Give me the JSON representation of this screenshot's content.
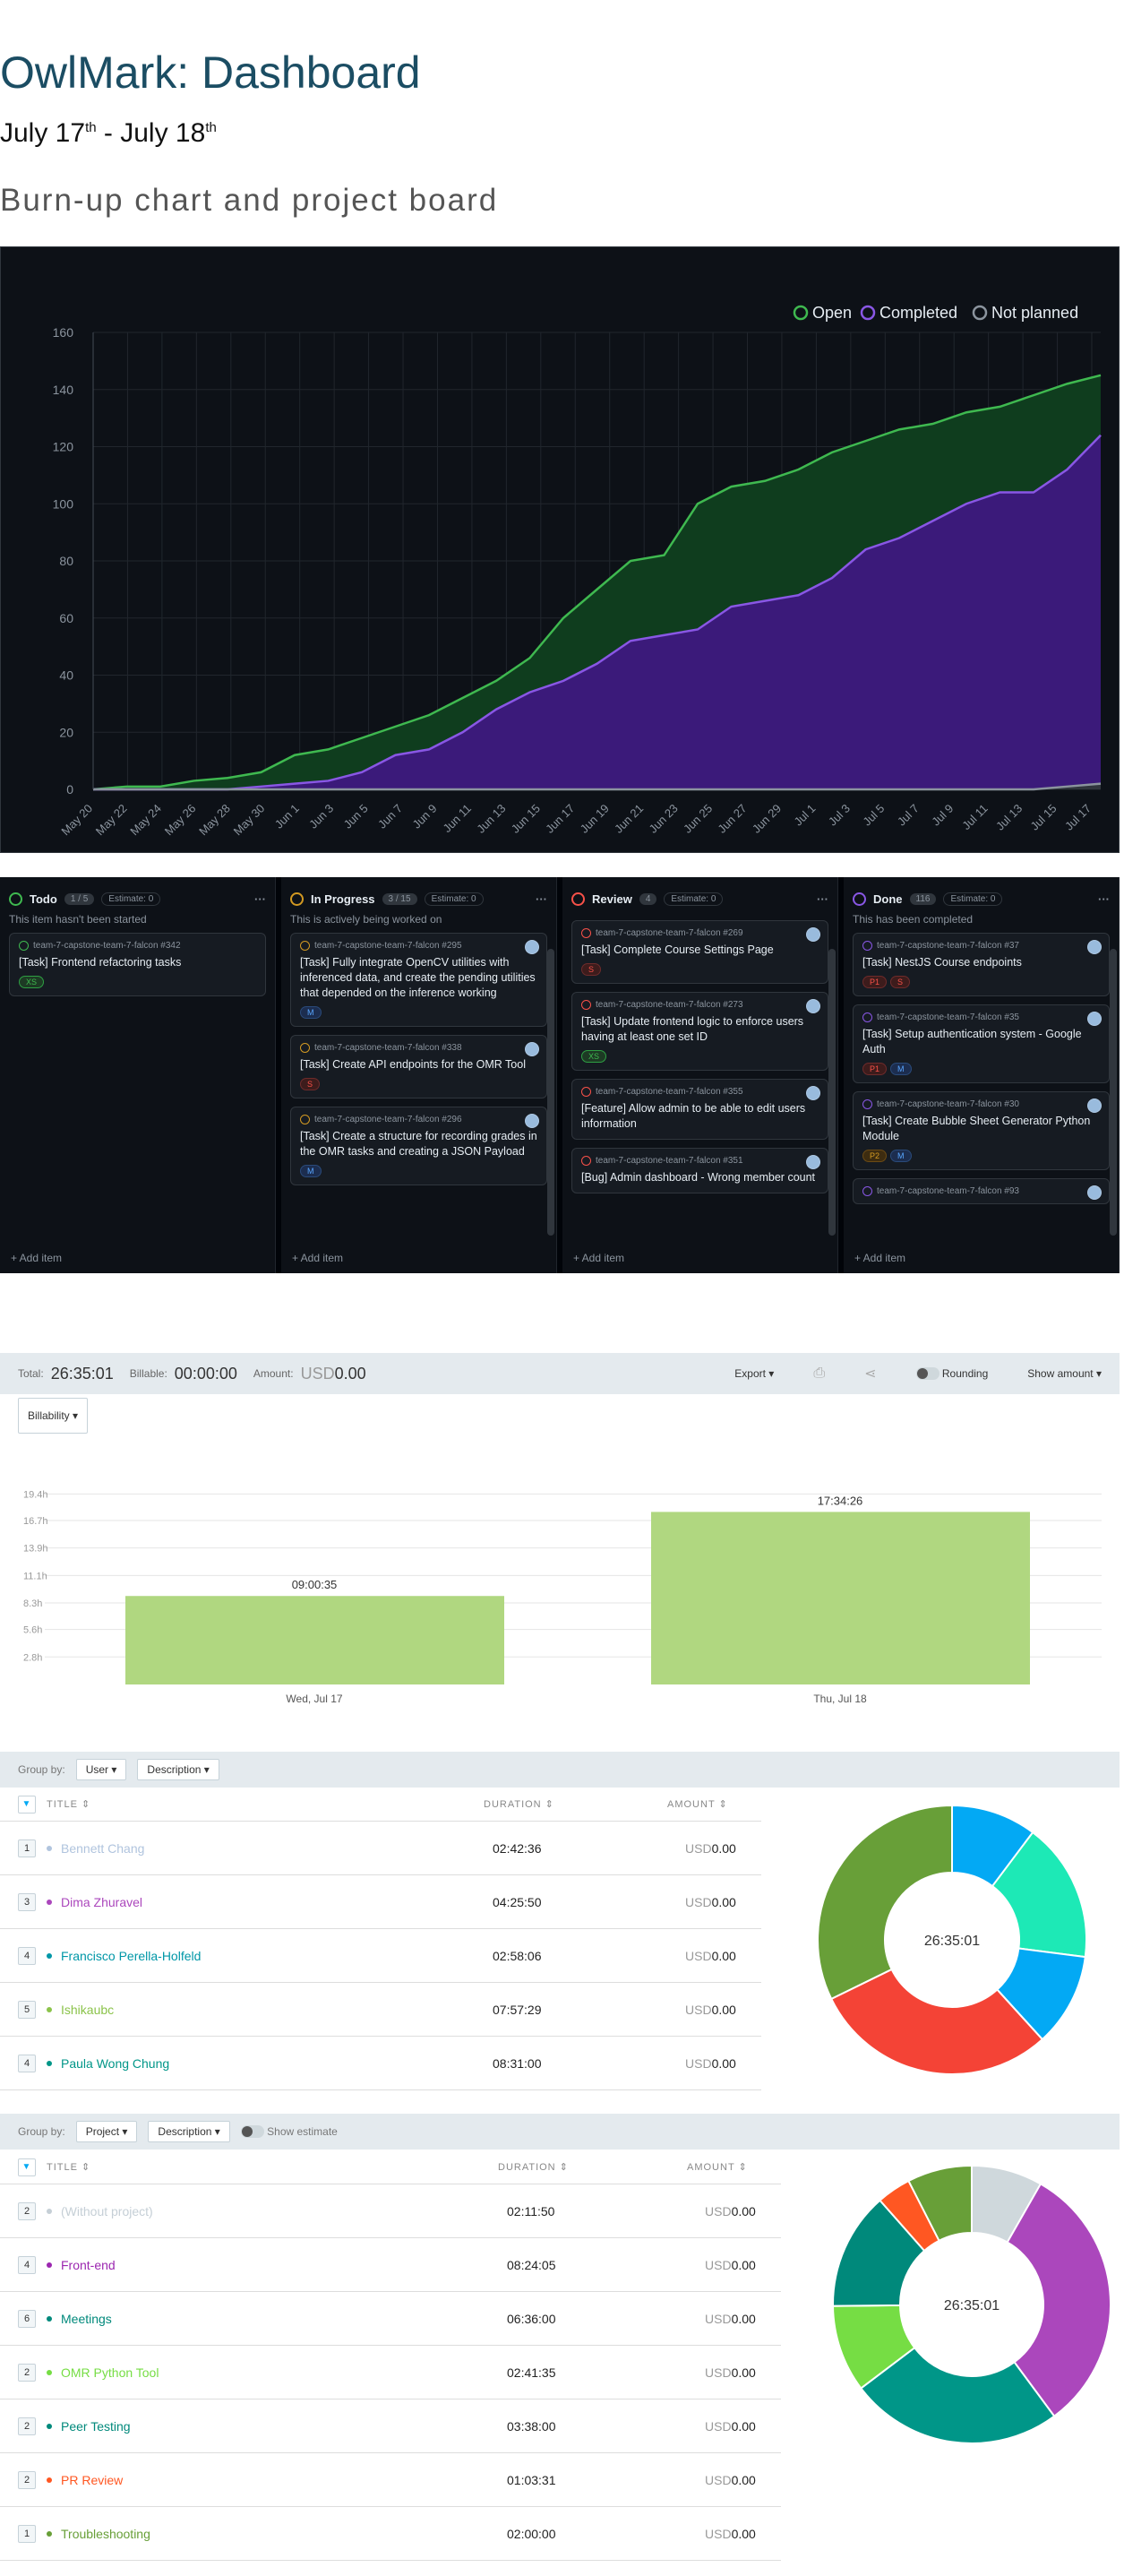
{
  "header": {
    "title": "OwlMark: Dashboard",
    "date_from": "July 17",
    "date_from_sup": "th",
    "date_sep": " - ",
    "date_to": "July 18",
    "date_to_sup": "th",
    "subtitle": "Burn-up chart and project board"
  },
  "chart_data": [
    {
      "type": "area",
      "legend": [
        "Open",
        "Completed",
        "Not planned"
      ],
      "colors": {
        "Open": "#3fb950",
        "Completed": "#8957e5",
        "Not planned": "#8b949e"
      },
      "x": [
        "May 20",
        "May 22",
        "May 24",
        "May 26",
        "May 28",
        "May 30",
        "Jun 1",
        "Jun 3",
        "Jun 5",
        "Jun 7",
        "Jun 9",
        "Jun 11",
        "Jun 13",
        "Jun 15",
        "Jun 17",
        "Jun 19",
        "Jun 21",
        "Jun 23",
        "Jun 25",
        "Jun 27",
        "Jun 29",
        "Jul 1",
        "Jul 3",
        "Jul 5",
        "Jul 7",
        "Jul 9",
        "Jul 11",
        "Jul 13",
        "Jul 15",
        "Jul 17"
      ],
      "ylim": [
        0,
        160
      ],
      "yticks": [
        0,
        20,
        40,
        60,
        80,
        100,
        120,
        140,
        160
      ],
      "series": [
        {
          "name": "Open",
          "values": [
            0,
            1,
            1,
            3,
            4,
            6,
            12,
            14,
            18,
            22,
            26,
            32,
            38,
            46,
            60,
            70,
            80,
            82,
            100,
            106,
            108,
            112,
            118,
            122,
            126,
            128,
            132,
            134,
            138,
            142,
            145
          ]
        },
        {
          "name": "Completed",
          "values": [
            0,
            0,
            0,
            0,
            0,
            1,
            2,
            3,
            6,
            12,
            14,
            20,
            28,
            34,
            38,
            44,
            52,
            54,
            56,
            64,
            66,
            68,
            74,
            84,
            88,
            94,
            100,
            104,
            104,
            112,
            124
          ]
        },
        {
          "name": "Not planned",
          "values": [
            0,
            0,
            0,
            0,
            0,
            0,
            0,
            0,
            0,
            0,
            0,
            0,
            0,
            0,
            0,
            0,
            0,
            0,
            0,
            0,
            0,
            0,
            0,
            0,
            0,
            0,
            0,
            0,
            0,
            1,
            2
          ]
        }
      ]
    },
    {
      "type": "bar",
      "categories": [
        "Wed, Jul 17",
        "Thu, Jul 18"
      ],
      "values": [
        9.01,
        17.57
      ],
      "labels": [
        "09:00:35",
        "17:34:26"
      ],
      "yticks": [
        "19.4h",
        "16.7h",
        "13.9h",
        "11.1h",
        "8.3h",
        "5.6h",
        "2.8h"
      ],
      "color": "#b0d780"
    },
    {
      "type": "pie",
      "center_label": "26:35:01",
      "slices": [
        {
          "label": "Bennett Chang",
          "value": 9757,
          "color": "#03a9f4"
        },
        {
          "label": "Dima Zhuravel",
          "value": 15950,
          "color": "#1de9b6"
        },
        {
          "label": "Francisco Perella-Holfeld",
          "value": 10686,
          "color": "#03a9f4"
        },
        {
          "label": "Ishikaubc",
          "value": 28049,
          "color": "#f44336"
        },
        {
          "label": "Paula Wong Chung",
          "value": 30660,
          "color": "#689f38"
        }
      ]
    },
    {
      "type": "pie",
      "center_label": "26:35:01",
      "slices": [
        {
          "label": "(Without project)",
          "value": 7910,
          "color": "#cfd8dc"
        },
        {
          "label": "Front-end",
          "value": 30245,
          "color": "#ab47bc"
        },
        {
          "label": "Meetings",
          "value": 23760,
          "color": "#009688"
        },
        {
          "label": "OMR Python Tool",
          "value": 9695,
          "color": "#76dd44"
        },
        {
          "label": "Peer Testing",
          "value": 13080,
          "color": "#00897b"
        },
        {
          "label": "PR Review",
          "value": 3811,
          "color": "#ff5722"
        },
        {
          "label": "Troubleshooting",
          "value": 7200,
          "color": "#689f38"
        }
      ]
    }
  ],
  "board": {
    "add_item": "Add item",
    "columns": [
      {
        "name": "Todo",
        "count": "1 / 5",
        "estimate": "Estimate: 0",
        "desc": "This item hasn't been started",
        "color": "#3fb950",
        "cards": [
          {
            "ref": "team-7-capstone-team-7-falcon #342",
            "title": "[Task] Frontend refactoring tasks",
            "tags": [
              "XS"
            ]
          }
        ]
      },
      {
        "name": "In Progress",
        "count": "3 / 15",
        "estimate": "Estimate: 0",
        "desc": "This is actively being worked on",
        "color": "#d29922",
        "cards": [
          {
            "ref": "team-7-capstone-team-7-falcon #295",
            "title": "[Task] Fully integrate OpenCV utilities with inferenced data, and create the pending utilities that depended on the inference working",
            "tags": [
              "M"
            ]
          },
          {
            "ref": "team-7-capstone-team-7-falcon #338",
            "title": "[Task] Create API endpoints for the OMR Tool",
            "tags": [
              "S"
            ]
          },
          {
            "ref": "team-7-capstone-team-7-falcon #296",
            "title": "[Task] Create a structure for recording grades in the OMR tasks and creating a JSON Payload",
            "tags": [
              "M"
            ]
          }
        ]
      },
      {
        "name": "Review",
        "count": "4",
        "estimate": "Estimate: 0",
        "desc": "",
        "color": "#f85149",
        "cards": [
          {
            "ref": "team-7-capstone-team-7-falcon #269",
            "title": "[Task] Complete Course Settings Page",
            "tags": [
              "S"
            ]
          },
          {
            "ref": "team-7-capstone-team-7-falcon #273",
            "title": "[Task] Update frontend logic to enforce users having at least one set ID",
            "tags": [
              "XS"
            ]
          },
          {
            "ref": "team-7-capstone-team-7-falcon #355",
            "title": "[Feature] Allow admin to be able to edit users information",
            "tags": []
          },
          {
            "ref": "team-7-capstone-team-7-falcon #351",
            "title": "[Bug] Admin dashboard - Wrong member count",
            "tags": []
          }
        ]
      },
      {
        "name": "Done",
        "count": "116",
        "estimate": "Estimate: 0",
        "desc": "This has been completed",
        "color": "#8957e5",
        "cards": [
          {
            "ref": "team-7-capstone-team-7-falcon #37",
            "title": "[Task] NestJS Course endpoints",
            "tags": [
              "P1",
              "S"
            ]
          },
          {
            "ref": "team-7-capstone-team-7-falcon #35",
            "title": "[Task] Setup authentication system - Google Auth",
            "tags": [
              "P1",
              "M"
            ]
          },
          {
            "ref": "team-7-capstone-team-7-falcon #30",
            "title": "[Task] Create Bubble Sheet Generator Python Module",
            "tags": [
              "P2",
              "M"
            ]
          },
          {
            "ref": "team-7-capstone-team-7-falcon #93",
            "title": "",
            "tags": []
          }
        ]
      }
    ]
  },
  "summary": {
    "total_label": "Total:",
    "total": "26:35:01",
    "billable_label": "Billable:",
    "billable": "00:00:00",
    "amount_label": "Amount:",
    "amount_cur": "USD",
    "amount": "0.00",
    "export": "Export",
    "rounding": "Rounding",
    "show_amount": "Show amount",
    "billability": "Billability"
  },
  "group1": {
    "label": "Group by:",
    "by1": "User",
    "by2": "Description",
    "col_title": "TITLE",
    "col_dur": "DURATION",
    "col_amt": "AMOUNT",
    "rows": [
      {
        "n": "1",
        "name": "Bennett Chang",
        "dur": "02:42:36",
        "color": "#b0c4de"
      },
      {
        "n": "3",
        "name": "Dima Zhuravel",
        "dur": "04:25:50",
        "color": "#ab47bc"
      },
      {
        "n": "4",
        "name": "Francisco Perella-Holfeld",
        "dur": "02:58:06",
        "color": "#0097a7"
      },
      {
        "n": "5",
        "name": "Ishikaubc",
        "dur": "07:57:29",
        "color": "#8bc34a"
      },
      {
        "n": "4",
        "name": "Paula Wong Chung",
        "dur": "08:31:00",
        "color": "#009688"
      }
    ]
  },
  "group2": {
    "label": "Group by:",
    "by1": "Project",
    "by2": "Description",
    "show_estimate": "Show estimate",
    "col_title": "TITLE",
    "col_dur": "DURATION",
    "col_amt": "AMOUNT",
    "rows": [
      {
        "n": "2",
        "name": "(Without project)",
        "dur": "02:11:50",
        "color": "#c5cfd6"
      },
      {
        "n": "4",
        "name": "Front-end",
        "dur": "08:24:05",
        "color": "#9c27b0"
      },
      {
        "n": "6",
        "name": "Meetings",
        "dur": "06:36:00",
        "color": "#00897b"
      },
      {
        "n": "2",
        "name": "OMR Python Tool",
        "dur": "02:41:35",
        "color": "#76dd44"
      },
      {
        "n": "2",
        "name": "Peer Testing",
        "dur": "03:38:00",
        "color": "#00897b"
      },
      {
        "n": "2",
        "name": "PR Review",
        "dur": "01:03:31",
        "color": "#ff5722"
      },
      {
        "n": "1",
        "name": "Troubleshooting",
        "dur": "02:00:00",
        "color": "#689f38"
      }
    ]
  },
  "amount_row": {
    "cur": "USD",
    "val": "0.00"
  }
}
